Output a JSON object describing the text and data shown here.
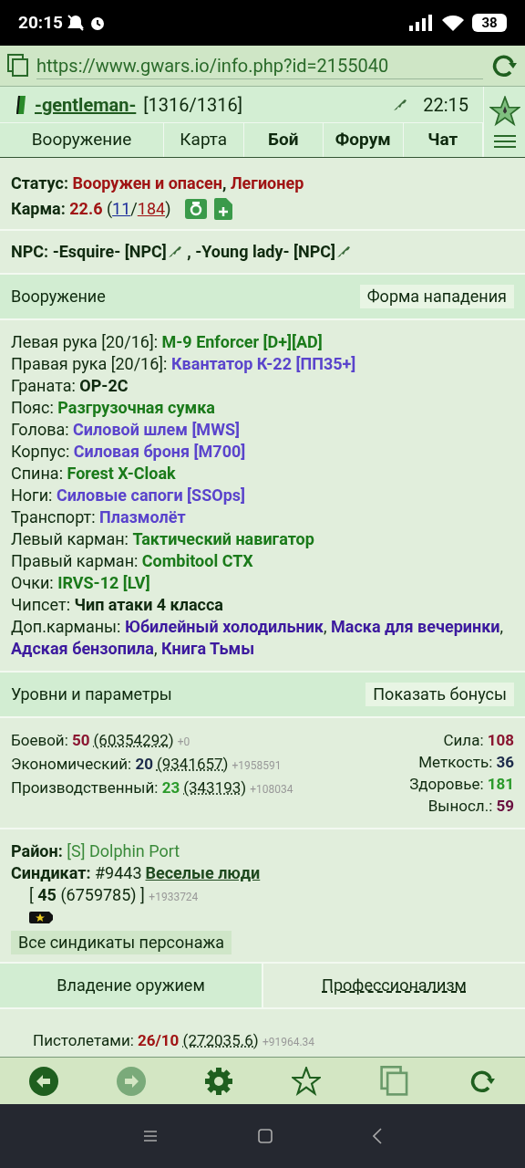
{
  "status_bar": {
    "time": "20:15",
    "battery": "38"
  },
  "browser": {
    "url": "https://www.gwars.io/info.php?id=2155040"
  },
  "header": {
    "name": "-gentleman-",
    "hp": "[1316/1316]",
    "time": "22:15"
  },
  "nav_tabs": [
    {
      "label": "Вооружение",
      "bold": false
    },
    {
      "label": "Карта",
      "bold": false
    },
    {
      "label": "Бой",
      "bold": true
    },
    {
      "label": "Форум",
      "bold": true
    },
    {
      "label": "Чат",
      "bold": true
    }
  ],
  "status": {
    "label": "Статус:",
    "values": [
      "Вооружен и опасен",
      "Легионер"
    ],
    "separator": ","
  },
  "karma": {
    "label": "Карма:",
    "value": "22.6",
    "open": "(",
    "plus": "11",
    "slash": "/",
    "minus": "184",
    "close": ")"
  },
  "npc": {
    "label": "NPC:",
    "items": [
      {
        "name": "-Esquire- [NPC]",
        "separator": ","
      },
      {
        "name": "-Young lady- [NPC]"
      }
    ]
  },
  "armament": {
    "title": "Вооружение",
    "button": "Форма нападения",
    "items": [
      {
        "label": "Левая рука [20/16]:",
        "values": [
          {
            "text": "M-9 Enforcer [D+][AD]",
            "color": "#1a7a1a"
          }
        ]
      },
      {
        "label": "Правая рука [20/16]:",
        "values": [
          {
            "text": "Квантатор К-22 [ПП35+]",
            "color": "#5a44cc"
          }
        ]
      },
      {
        "label": "Граната:",
        "values": [
          {
            "text": "OP-2C",
            "color": "#0f2a0f"
          }
        ]
      },
      {
        "label": "Пояс:",
        "values": [
          {
            "text": "Разгрузочная сумка",
            "color": "#1a7a1a"
          }
        ]
      },
      {
        "label": "Голова:",
        "values": [
          {
            "text": "Силовой шлем [MWS]",
            "color": "#5a44cc"
          }
        ]
      },
      {
        "label": "Корпус:",
        "values": [
          {
            "text": "Силовая броня [M700]",
            "color": "#5a44cc"
          }
        ]
      },
      {
        "label": "Спина:",
        "values": [
          {
            "text": "Forest X-Cloak",
            "color": "#1a7a1a"
          }
        ]
      },
      {
        "label": "Ноги:",
        "values": [
          {
            "text": "Силовые сапоги [SSOps]",
            "color": "#5a44cc"
          }
        ]
      },
      {
        "label": "Транспорт:",
        "values": [
          {
            "text": "Плазмолёт",
            "color": "#5a44cc"
          }
        ]
      },
      {
        "label": "Левый карман:",
        "values": [
          {
            "text": "Тактический навигатор",
            "color": "#1a7a1a"
          }
        ]
      },
      {
        "label": "Правый карман:",
        "values": [
          {
            "text": "Combitool CTX",
            "color": "#1a7a1a"
          }
        ]
      },
      {
        "label": "Очки:",
        "values": [
          {
            "text": "IRVS-12 [LV]",
            "color": "#1a7a1a"
          }
        ]
      },
      {
        "label": "Чипсет:",
        "values": [
          {
            "text": "Чип атаки 4 класса",
            "color": "#0f2a0f"
          }
        ]
      },
      {
        "label": "Доп.карманы:",
        "values": [
          {
            "text": "Юбилейный холодильник",
            "color": "#3c1a9e",
            "suffix": ","
          },
          {
            "text": "Маска для вечеринки",
            "color": "#3c1a9e",
            "suffix": ","
          },
          {
            "text": "Адская бензопила",
            "color": "#3c1a9e",
            "suffix": ","
          },
          {
            "text": "Книга Тьмы",
            "color": "#3c1a9e"
          }
        ]
      }
    ]
  },
  "levels": {
    "title": "Уровни и параметры",
    "button": "Показать бонусы",
    "rows": [
      {
        "label": "Боевой:",
        "level_value": "50",
        "color": "#8a1530",
        "exp": "(60354292)",
        "gain": "+0"
      },
      {
        "label": "Экономический:",
        "level_value": "20",
        "color": "#1c2a4a",
        "exp": "(9341657)",
        "gain": "+1958591"
      },
      {
        "label": "Производственный:",
        "level_value": "23",
        "color": "#2a9a2a",
        "exp": "(343193)",
        "gain": "+108034"
      }
    ],
    "stats": [
      {
        "label": "Сила:",
        "value": "108",
        "color": "#8a1530"
      },
      {
        "label": "Меткость:",
        "value": "36",
        "color": "#1c2a4a"
      },
      {
        "label": "Здоровье:",
        "value": "181",
        "color": "#2a9a2a"
      },
      {
        "label": "Выносл.:",
        "value": "59",
        "color": "#6a1040"
      }
    ]
  },
  "district": {
    "label": "Район:",
    "value": "[S] Dolphin Port"
  },
  "syndicate": {
    "label": "Синдикат:",
    "number": "#9443",
    "name": "Веселые люди",
    "open": "[",
    "level": "45",
    "exp": "(6759785)",
    "close": "]",
    "gain": "+1933724",
    "button": "Все синдикаты персонажа"
  },
  "skill_tabs": [
    {
      "label": "Владение оружием",
      "selected": true
    },
    {
      "label": "Профессионализм",
      "selected": false
    }
  ],
  "skills": [
    {
      "label": "Пистолетами:",
      "value": "26/10",
      "exp": "(272035.6)",
      "gain": "+91964.34"
    }
  ]
}
